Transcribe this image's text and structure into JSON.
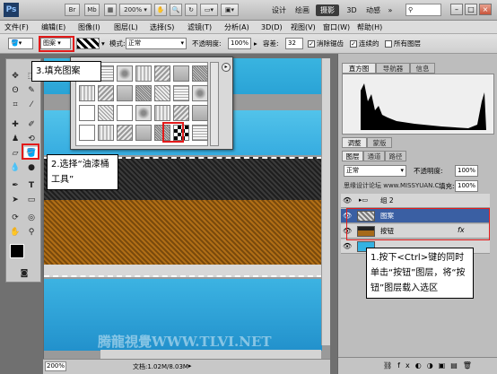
{
  "app": {
    "logo": "Ps",
    "zoom": "200%"
  },
  "appbar": {
    "buttons": [
      "Br",
      "Mb"
    ],
    "workspaces": [
      "设计",
      "绘画",
      "摄影",
      "3D",
      "动感"
    ],
    "active_workspace": "摄影",
    "more": "»"
  },
  "menu": [
    "文件(F)",
    "编辑(E)",
    "图像(I)",
    "图层(L)",
    "选择(S)",
    "滤镜(T)",
    "分析(A)",
    "3D(D)",
    "视图(V)",
    "窗口(W)",
    "帮助(H)"
  ],
  "options": {
    "fill_source": "图案",
    "mode_label": "模式:",
    "mode_value": "正常",
    "opacity_label": "不透明度:",
    "opacity_value": "100%",
    "tolerance_label": "容差:",
    "tolerance_value": "32",
    "antialias": "消除锯齿",
    "contiguous": "连续的",
    "all_layers": "所有图层"
  },
  "right_panel": {
    "top_tabs": [
      "直方图",
      "导航器",
      "信息"
    ],
    "mid_tabs": [
      "调整",
      "蒙版"
    ],
    "layer_tabs": [
      "图层",
      "通道",
      "路径"
    ],
    "blend_mode": "正常",
    "opacity_label": "不透明度:",
    "opacity_value": "100%",
    "fill_label": "填充:",
    "fill_value": "100%",
    "watermark": "思缘设计论坛 www.MISSYUAN.COM",
    "layers": [
      {
        "name": "组 2"
      },
      {
        "name": "图案"
      },
      {
        "name": "按钮"
      },
      {
        "name": ""
      }
    ],
    "fx": "fx"
  },
  "status": {
    "doc": "文档:1.02M/8.03M"
  },
  "canvas_watermark": "腾龍視覺WWW.TLVI.NET",
  "callouts": {
    "step3": "3.填充图案",
    "step2": "2.选择“油漆桶工具”",
    "step1": "1.按下<Ctrl>键的同时单击“按钮”图层，将“按钮”图层载入选区"
  }
}
